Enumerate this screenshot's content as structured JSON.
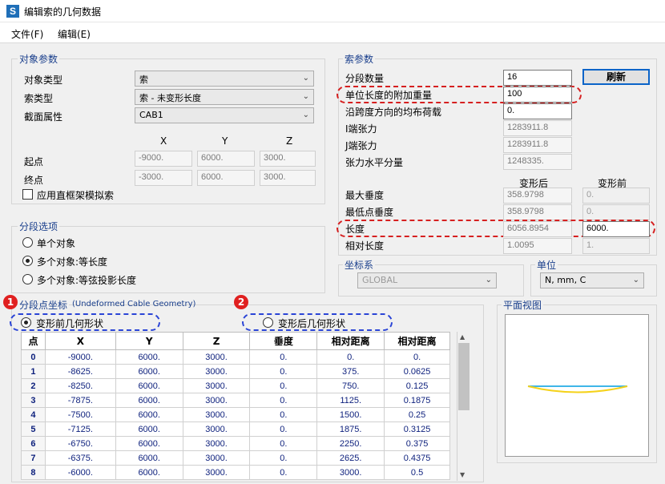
{
  "window": {
    "title": "编辑索的几何数据",
    "app_icon": "S"
  },
  "menu": {
    "file": "文件(F)",
    "edit": "编辑(E)"
  },
  "object_params": {
    "group_label": "对象参数",
    "object_type_label": "对象类型",
    "object_type_value": "索",
    "cable_type_label": "索类型",
    "cable_type_value": "索 - 未变形长度",
    "section_label": "截面属性",
    "section_value": "CAB1",
    "col_x": "X",
    "col_y": "Y",
    "col_z": "Z",
    "start_label": "起点",
    "start_x": "-9000.",
    "start_y": "6000.",
    "start_z": "3000.",
    "end_label": "终点",
    "end_x": "-3000.",
    "end_y": "6000.",
    "end_z": "3000.",
    "frame_model_label": "应用直框架模拟索"
  },
  "segment_options": {
    "group_label": "分段选项",
    "single": "单个对象",
    "multi_equal": "多个对象:等长度",
    "multi_chord": "多个对象:等弦投影长度"
  },
  "cable_params": {
    "group_label": "索参数",
    "num_segments_label": "分段数量",
    "num_segments_value": "16",
    "refresh_button": "刷新",
    "added_weight_label": "单位长度的附加重量",
    "added_weight_value": "100",
    "uniform_load_label": "沿跨度方向的均布荷载",
    "uniform_load_value": "0.",
    "i_tension_label": "I端张力",
    "i_tension_value": "1283911.8",
    "j_tension_label": "J端张力",
    "j_tension_value": "1283911.8",
    "horiz_tension_label": "张力水平分量",
    "horiz_tension_value": "1248335.",
    "deformed_header": "变形后",
    "undeformed_header": "变形前",
    "max_sag_label": "最大垂度",
    "max_sag_def": "358.9798",
    "max_sag_undef": "0.",
    "low_sag_label": "最低点垂度",
    "low_sag_def": "358.9798",
    "low_sag_undef": "0.",
    "length_label": "长度",
    "length_def": "6056.8954",
    "length_undef": "6000.",
    "rel_length_label": "相对长度",
    "rel_length_def": "1.0095",
    "rel_length_undef": "1."
  },
  "coords": {
    "label": "坐标系",
    "value": "GLOBAL"
  },
  "units": {
    "label": "单位",
    "value": "N, mm, C"
  },
  "plan_view": {
    "label": "平面视图"
  },
  "seg_coords": {
    "group_label": "分段点坐标",
    "subtitle": "(Undeformed Cable Geometry)",
    "badge1": "1",
    "badge2": "2",
    "undeformed_radio": "变形前几何形状",
    "deformed_radio": "变形后几何形状",
    "headers": [
      "点",
      "X",
      "Y",
      "Z",
      "垂度",
      "相对距离",
      "相对距离"
    ],
    "rows": [
      [
        "0",
        "-9000.",
        "6000.",
        "3000.",
        "0.",
        "0.",
        "0."
      ],
      [
        "1",
        "-8625.",
        "6000.",
        "3000.",
        "0.",
        "375.",
        "0.0625"
      ],
      [
        "2",
        "-8250.",
        "6000.",
        "3000.",
        "0.",
        "750.",
        "0.125"
      ],
      [
        "3",
        "-7875.",
        "6000.",
        "3000.",
        "0.",
        "1125.",
        "0.1875"
      ],
      [
        "4",
        "-7500.",
        "6000.",
        "3000.",
        "0.",
        "1500.",
        "0.25"
      ],
      [
        "5",
        "-7125.",
        "6000.",
        "3000.",
        "0.",
        "1875.",
        "0.3125"
      ],
      [
        "6",
        "-6750.",
        "6000.",
        "3000.",
        "0.",
        "2250.",
        "0.375"
      ],
      [
        "7",
        "-6375.",
        "6000.",
        "3000.",
        "0.",
        "2625.",
        "0.4375"
      ],
      [
        "8",
        "-6000.",
        "6000.",
        "3000.",
        "0.",
        "3000.",
        "0.5"
      ]
    ]
  },
  "colors": {
    "accent": "#0b64c8",
    "highlight_red": "#d62020",
    "highlight_blue": "#2a44d6",
    "cable_yellow": "#f5d21a",
    "cable_cyan": "#3fb6e8"
  },
  "icons": {
    "dropdown": "chevron-down-icon",
    "scroll_up": "arrow-up-icon",
    "scroll_down": "arrow-down-icon"
  }
}
